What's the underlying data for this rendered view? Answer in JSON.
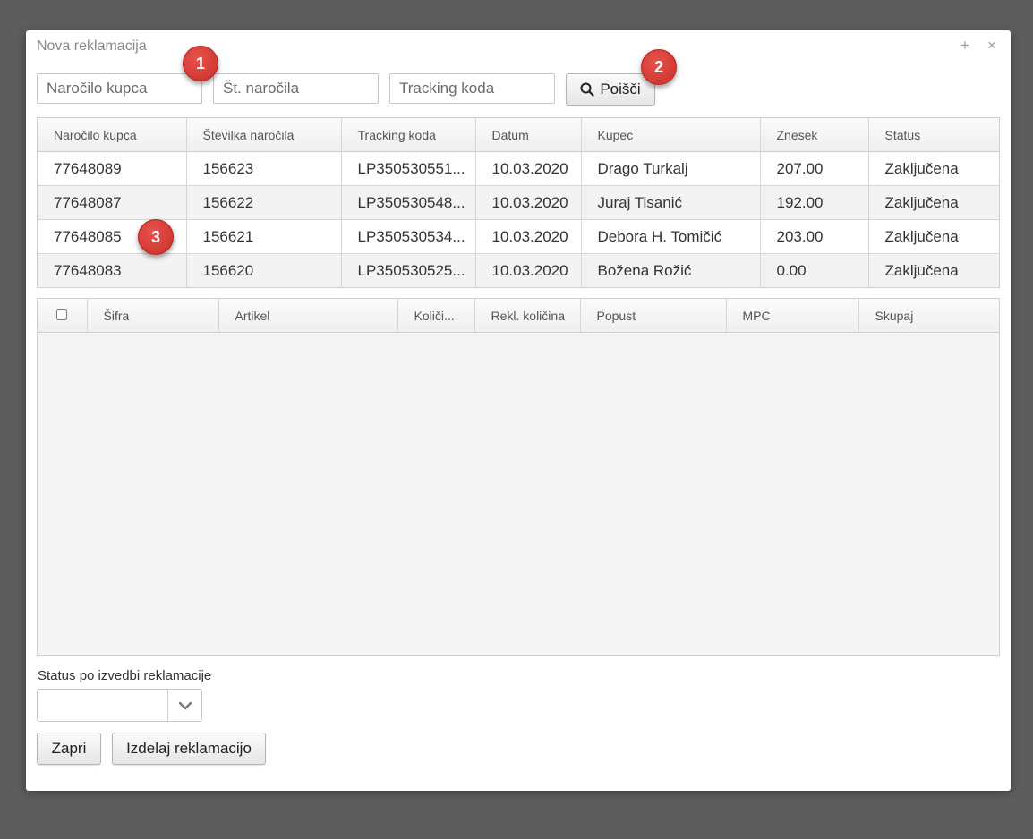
{
  "dialog": {
    "title": "Nova reklamacija",
    "plus_glyph": "+",
    "close_glyph": "×"
  },
  "filters": {
    "order_placeholder": "Naročilo kupca",
    "number_placeholder": "Št. naročila",
    "tracking_placeholder": "Tracking koda",
    "search_label": "Poišči",
    "search_icon": "search-icon"
  },
  "badges": [
    "1",
    "2",
    "3"
  ],
  "orders": {
    "columns": [
      "Naročilo kupca",
      "Številka naročila",
      "Tracking koda",
      "Datum",
      "Kupec",
      "Znesek",
      "Status"
    ],
    "rows": [
      [
        "77648089",
        "156623",
        "LP350530551...",
        "10.03.2020",
        "Drago Turkalj",
        "207.00",
        "Zaključena"
      ],
      [
        "77648087",
        "156622",
        "LP350530548...",
        "10.03.2020",
        "Juraj Tisanić",
        "192.00",
        "Zaključena"
      ],
      [
        "77648085",
        "156621",
        "LP350530534...",
        "10.03.2020",
        "Debora H. Tomičić",
        "203.00",
        "Zaključena"
      ],
      [
        "77648083",
        "156620",
        "LP350530525...",
        "10.03.2020",
        "Božena Rožić",
        "0.00",
        "Zaključena"
      ]
    ]
  },
  "items": {
    "columns": [
      "Šifra",
      "Artikel",
      "Količi...",
      "Rekl. količina",
      "Popust",
      "MPC",
      "Skupaj"
    ]
  },
  "status_section": {
    "label": "Status po izvedbi reklamacije",
    "selected": ""
  },
  "footer": {
    "close_label": "Zapri",
    "create_label": "Izdelaj reklamacijo"
  },
  "colors": {
    "badge": "#d63a33",
    "overlay": "#5d5d5d",
    "row_alt": "#f3f3f3"
  }
}
